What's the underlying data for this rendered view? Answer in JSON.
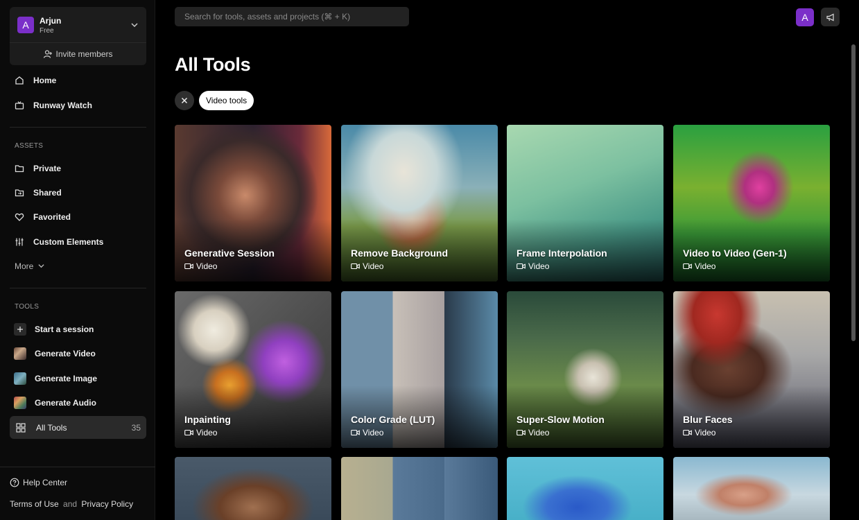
{
  "account": {
    "initial": "A",
    "name": "Arjun",
    "plan": "Free",
    "invite_label": "Invite members"
  },
  "nav": {
    "home": "Home",
    "watch": "Runway Watch"
  },
  "assets": {
    "label": "ASSETS",
    "items": [
      "Private",
      "Shared",
      "Favorited",
      "Custom Elements"
    ],
    "more": "More"
  },
  "tools": {
    "label": "TOOLS",
    "items": [
      "Start a session",
      "Generate Video",
      "Generate Image",
      "Generate Audio"
    ],
    "all_tools": "All Tools",
    "all_tools_count": "35"
  },
  "footer": {
    "help": "Help Center",
    "terms": "Terms of Use",
    "and": "and",
    "privacy": "Privacy Policy"
  },
  "search": {
    "placeholder": "Search for tools, assets and projects (⌘ + K)"
  },
  "user": {
    "initial": "A"
  },
  "page": {
    "title": "All Tools",
    "filter": "Video tools"
  },
  "cards": [
    {
      "title": "Generative Session",
      "tag": "Video"
    },
    {
      "title": "Remove Background",
      "tag": "Video"
    },
    {
      "title": "Frame Interpolation",
      "tag": "Video"
    },
    {
      "title": "Video to Video (Gen-1)",
      "tag": "Video"
    },
    {
      "title": "Inpainting",
      "tag": "Video"
    },
    {
      "title": "Color Grade (LUT)",
      "tag": "Video"
    },
    {
      "title": "Super-Slow Motion",
      "tag": "Video"
    },
    {
      "title": "Blur Faces",
      "tag": "Video"
    }
  ],
  "colors": {
    "accent": "#7b2fc9",
    "background": "#000000",
    "sidebar": "#0b0b0b"
  }
}
